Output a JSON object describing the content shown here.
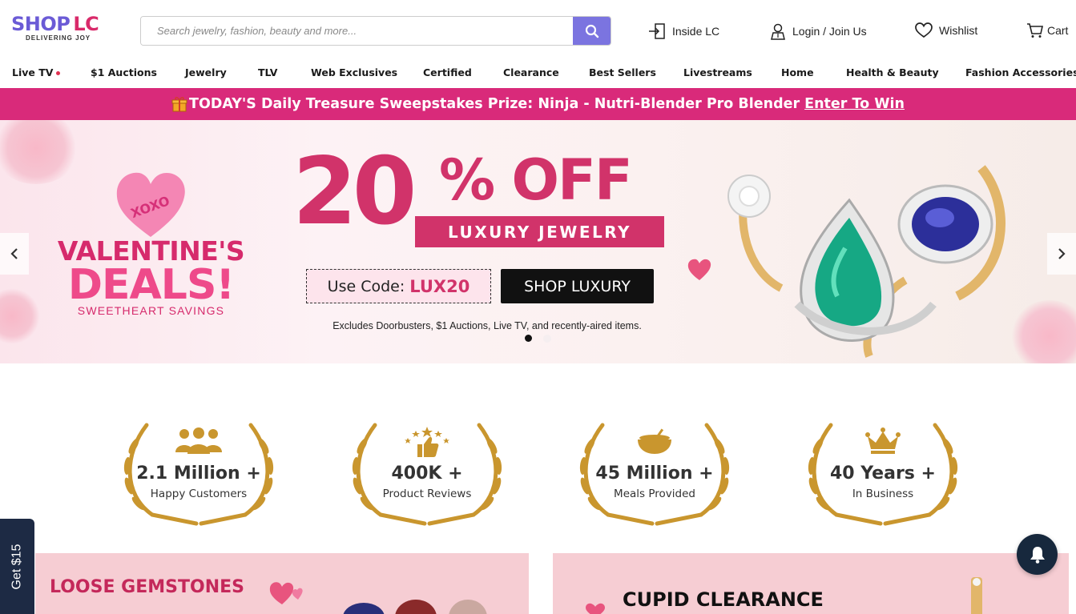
{
  "header": {
    "logo_main_shop": "SHOP",
    "logo_main_lc": "LC",
    "logo_sub": "DELIVERING JOY",
    "search_placeholder": "Search jewelry, fashion, beauty and more...",
    "inside_lc": "Inside LC",
    "login": "Login / Join Us",
    "wishlist": "Wishlist",
    "cart": "Cart"
  },
  "nav": {
    "items": [
      "Live TV",
      "$1 Auctions",
      "Jewelry",
      "TLV",
      "Web Exclusives",
      "Certified",
      "Clearance",
      "Best Sellers",
      "Livestreams",
      "Home",
      "Health & Beauty",
      "Fashion Accessories"
    ]
  },
  "promo": {
    "text": "TODAY'S Daily Treasure Sweepstakes Prize: Ninja - Nutri-Blender Pro Blender",
    "link": "Enter To Win"
  },
  "hero": {
    "heart_text": "XOXO",
    "title_line1": "VALENTINE'S",
    "title_line2": "DEALS!",
    "subtitle": "SWEETHEART SAVINGS",
    "percent": "20",
    "off": "% OFF",
    "banner": "LUXURY JEWELRY",
    "code_label": "Use Code:",
    "code": "LUX20",
    "cta": "SHOP LUXURY",
    "exclusions": "Excludes Doorbusters, $1 Auctions, Live TV, and recently-aired items.",
    "slides": 2,
    "active_slide": 1
  },
  "stats": [
    {
      "value": "2.1 Million +",
      "label": "Happy Customers",
      "icon": "people-icon"
    },
    {
      "value": "400K +",
      "label": "Product Reviews",
      "icon": "thumbs-up-stars-icon"
    },
    {
      "value": "45 Million +",
      "label": "Meals Provided",
      "icon": "meal-bowl-icon"
    },
    {
      "value": "40 Years +",
      "label": "In Business",
      "icon": "crown-icon"
    }
  ],
  "tiles": {
    "left_title": "LOOSE GEMSTONES",
    "right_title": "CUPID CLEARANCE"
  },
  "floating": {
    "get15": "Get $15"
  },
  "colors": {
    "brand_purple": "#6b5bd6",
    "brand_pink": "#d92a6a",
    "promo_bg": "#d92a7a",
    "gold": "#c9962e"
  }
}
